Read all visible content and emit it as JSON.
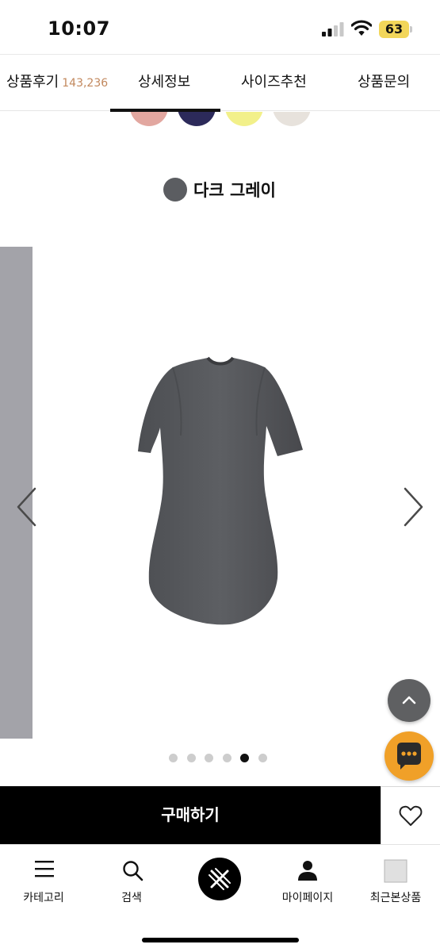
{
  "status_bar": {
    "time": "10:07",
    "battery": "63",
    "icons": [
      "cellular-signal-icon",
      "wifi-icon",
      "battery-icon"
    ]
  },
  "tabs": [
    {
      "label": "상품후기",
      "count": "143,236"
    },
    {
      "label": "상세정보",
      "active": true
    },
    {
      "label": "사이즈추천"
    },
    {
      "label": "상품문의"
    }
  ],
  "product": {
    "color_swatches": [
      "#e2a7a0",
      "#2c2a5a",
      "#f2f08a",
      "#e7e2dc"
    ],
    "selected_color": {
      "name": "다크 그레이",
      "hex": "#5b5d61"
    },
    "carousel": {
      "slide_count": 6,
      "active_index": 4
    }
  },
  "actions": {
    "buy_label": "구매하기",
    "icons": [
      "scroll-top-icon",
      "chat-icon",
      "heart-icon",
      "chevron-left-icon",
      "chevron-right-icon"
    ]
  },
  "bottom_nav": {
    "items": [
      {
        "label": "카테고리",
        "icon": "menu-icon"
      },
      {
        "label": "검색",
        "icon": "search-icon"
      },
      {
        "label": "",
        "icon": "home-logo-icon"
      },
      {
        "label": "마이페이지",
        "icon": "person-icon"
      },
      {
        "label": "최근본상품",
        "icon": "recent-product-icon"
      }
    ]
  },
  "colors": {
    "accent_review_count": "#c2885d",
    "buy_button": "#000000",
    "chat_button": "#f0a028"
  }
}
